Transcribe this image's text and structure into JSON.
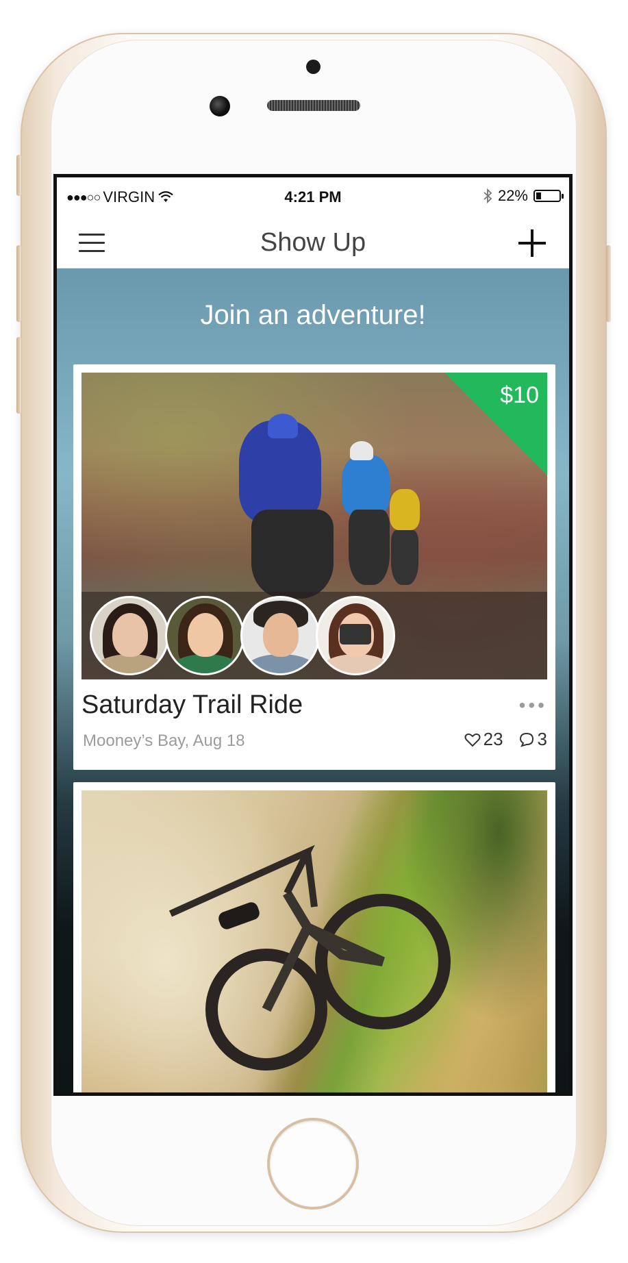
{
  "status_bar": {
    "signal": "●●●○○",
    "carrier": "VIRGIN",
    "time": "4:21 PM",
    "battery": "22%",
    "battery_level": 0.22
  },
  "nav": {
    "title": "Show Up"
  },
  "feed": {
    "heading": "Join an adventure!"
  },
  "events": [
    {
      "price": "$10",
      "title": "Saturday Trail Ride",
      "subtitle": "Mooney’s Bay, Aug 18",
      "likes": "23",
      "comments": "3",
      "more": "•••"
    }
  ],
  "colors": {
    "price_badge": "#22b95c",
    "feed_background_top": "#6a98ad",
    "feed_background_bottom": "#0f1517"
  },
  "icons": {
    "menu": "menu-icon",
    "add": "plus-icon",
    "like": "heart-icon",
    "comment": "comment-icon",
    "more": "more-dots-icon",
    "wifi": "wifi-icon",
    "bluetooth": "bluetooth-icon",
    "battery": "battery-icon"
  }
}
